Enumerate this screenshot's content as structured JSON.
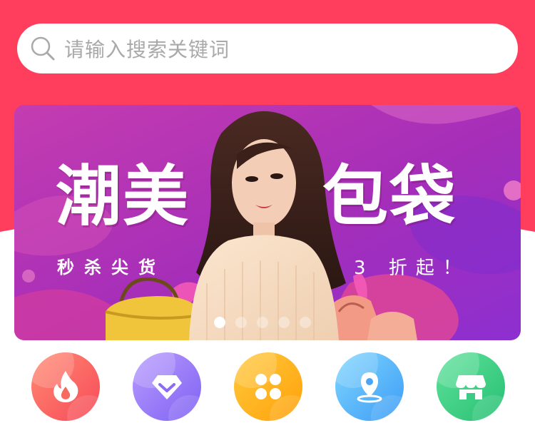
{
  "search": {
    "placeholder": "请输入搜索关键词",
    "icon": "search-icon"
  },
  "banner": {
    "title_left": "潮美",
    "title_right": "包袋",
    "subtitle_left": "秒杀尖货",
    "subtitle_right": "3 折起！",
    "slide_count": 5,
    "active_slide": 1
  },
  "categories": [
    {
      "icon": "fire-icon",
      "color": "#f74a5a"
    },
    {
      "icon": "diamond-icon",
      "color": "#7f62f2"
    },
    {
      "icon": "grid-icon",
      "color": "#ffa10a"
    },
    {
      "icon": "location-icon",
      "color": "#3d9cf5"
    },
    {
      "icon": "store-icon",
      "color": "#27bf74"
    }
  ],
  "colors": {
    "header": "#ff3d5c",
    "banner_primary": "#b431a5",
    "banner_secondary": "#8b2bc9"
  }
}
